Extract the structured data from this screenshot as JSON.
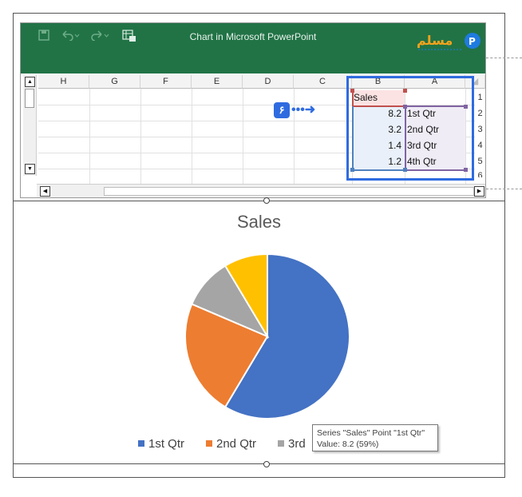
{
  "window": {
    "title": "Chart in Microsoft PowerPoint",
    "icons": [
      "save-icon",
      "undo-icon",
      "redo-icon",
      "edit-data-icon"
    ],
    "brand_color": "#217346"
  },
  "grid": {
    "columns": [
      "H",
      "G",
      "F",
      "E",
      "D",
      "C",
      "B",
      "A"
    ],
    "rows": [
      "1",
      "2",
      "3",
      "4",
      "5",
      "6"
    ],
    "header_cell": "Sales",
    "values": [
      "8.2",
      "3.2",
      "1.4",
      "1.2"
    ],
    "categories": [
      "1st Qtr",
      "2nd Qtr",
      "3rd Qtr",
      "4th Qtr"
    ],
    "annotation_badge": "۶"
  },
  "chart_data": {
    "type": "pie",
    "title": "Sales",
    "categories": [
      "1st Qtr",
      "2nd Qtr",
      "3rd Qtr",
      "4th Qtr"
    ],
    "values": [
      8.2,
      3.2,
      1.4,
      1.2
    ],
    "colors": [
      "#4472c4",
      "#ed7d31",
      "#a5a5a5",
      "#ffc000"
    ],
    "legend": [
      "1st Qtr",
      "2nd Qtr",
      "3rd"
    ],
    "legend_position": "bottom"
  },
  "tooltip": {
    "line1": "Series \"Sales\" Point \"1st Qtr\"",
    "line2": "Value: 8.2 (59%)"
  }
}
